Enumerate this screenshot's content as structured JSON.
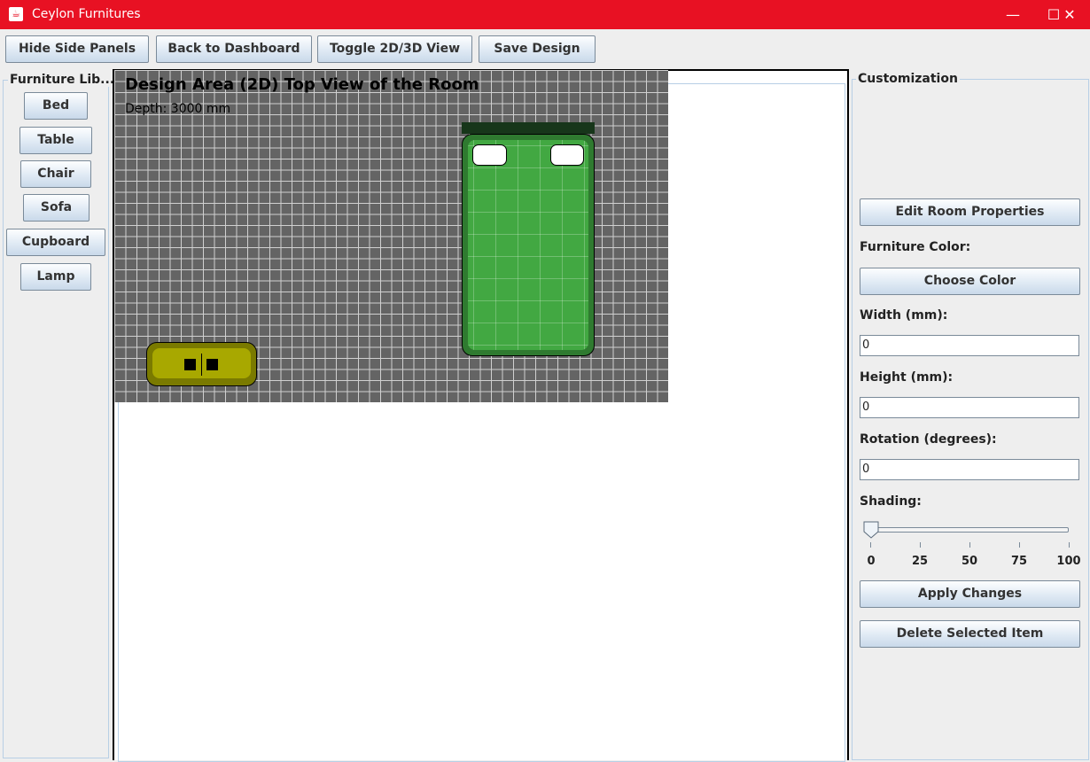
{
  "window": {
    "title": "Ceylon Furnitures",
    "app_icon": "java-cup-icon"
  },
  "toolbar": {
    "hide_panels": "Hide Side Panels",
    "back": "Back to Dashboard",
    "toggle": "Toggle 2D/3D View",
    "save": "Save Design"
  },
  "library": {
    "title": "Furniture Lib...",
    "items": [
      "Bed",
      "Table",
      "Chair",
      "Sofa",
      "Cupboard",
      "Lamp"
    ]
  },
  "design": {
    "title": "Design Area (2D) Top View of the Room",
    "depth": "Depth: 3000 mm"
  },
  "custom": {
    "title": "Customization",
    "edit_room": "Edit Room Properties",
    "color_label": "Furniture Color:",
    "choose_color": "Choose Color",
    "width_label": "Width (mm):",
    "width_value": "0",
    "height_label": "Height (mm):",
    "height_value": "0",
    "rotation_label": "Rotation (degrees):",
    "rotation_value": "0",
    "shading_label": "Shading:",
    "shading_value": 0,
    "ticks": [
      "0",
      "25",
      "50",
      "75",
      "100"
    ],
    "apply": "Apply Changes",
    "delete": "Delete Selected Item"
  },
  "colors": {
    "titlebar": "#e81123",
    "bed": "#42a842",
    "sofa": "#a8a800",
    "floor": "#646464"
  }
}
